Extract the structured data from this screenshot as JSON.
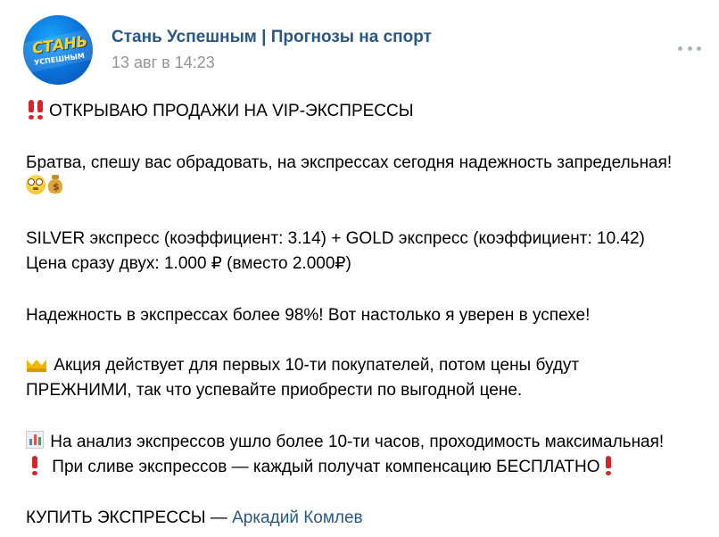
{
  "post": {
    "author": "Стань Успешным | Прогнозы на спорт",
    "date": "13 авг в 14:23",
    "avatar": {
      "line1": "СТАНЬ",
      "line2": "УСПЕШНЫМ"
    },
    "lines": {
      "l1": "ОТКРЫВАЮ ПРОДАЖИ НА VIP-ЭКСПРЕССЫ",
      "l2": "Братва, спешу вас обрадовать, на экспрессах сегодня надежность запредельная!",
      "l4": "SILVER экспресс (коэффициент: 3.14) + GOLD экспресс (коэффициент: 10.42)",
      "l5": "Цена сразу двух: 1.000 ₽ (вместо 2.000₽)",
      "l6": "Надежность в экспрессах более 98%! Вот настолько я уверен в успехе!",
      "l7": "Акция действует для первых 10-ти покупателей, потом цены будут",
      "l8": "ПРЕЖНИМИ, так что успевайте приобрести по выгодной цене.",
      "l9": "На анализ экспрессов ушло более 10-ти часов, проходимость максимальная!",
      "l10": "При сливе экспрессов — каждый получат компенсацию БЕСПЛАТНО",
      "l11_prefix": "КУПИТЬ ЭКСПРЕССЫ — ",
      "l11_link": "Аркадий Комлев"
    },
    "icons": [
      "double-exclamation-icon",
      "face-icon",
      "money-bag-icon",
      "crown-icon",
      "bar-chart-icon",
      "exclamation-icon"
    ],
    "colors": {
      "link": "#2a5885",
      "meta": "#939393",
      "alert": "#d4252b"
    }
  }
}
